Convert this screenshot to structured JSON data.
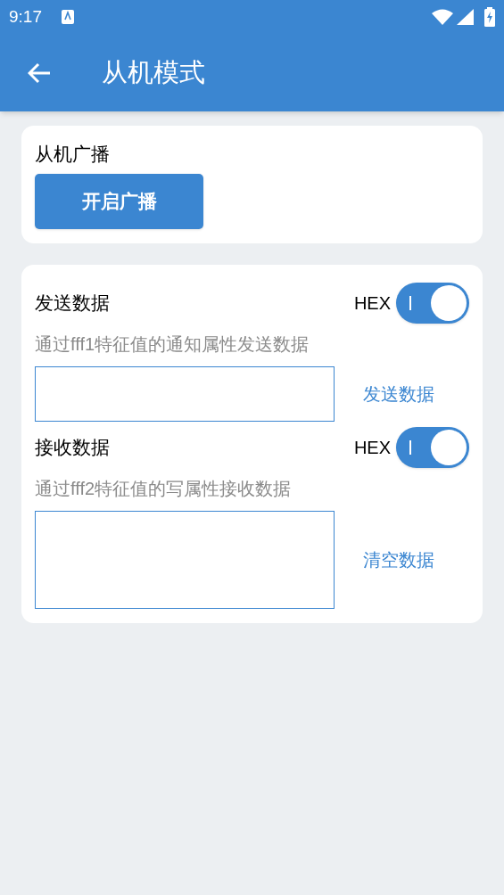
{
  "status_bar": {
    "time": "9:17"
  },
  "app_bar": {
    "title": "从机模式"
  },
  "broadcast": {
    "title": "从机广播",
    "button": "开启广播"
  },
  "sections": [
    {
      "kind": "line",
      "title": "发送数据",
      "hex_label": "HEX",
      "hex_on": true,
      "hint": "通过fff1特征值的通知属性发送数据",
      "action": "发送数据"
    },
    {
      "kind": "area",
      "title": "接收数据",
      "hex_label": "HEX",
      "hex_on": true,
      "hint": "通过fff2特征值的写属性接收数据",
      "action": "清空数据"
    }
  ]
}
